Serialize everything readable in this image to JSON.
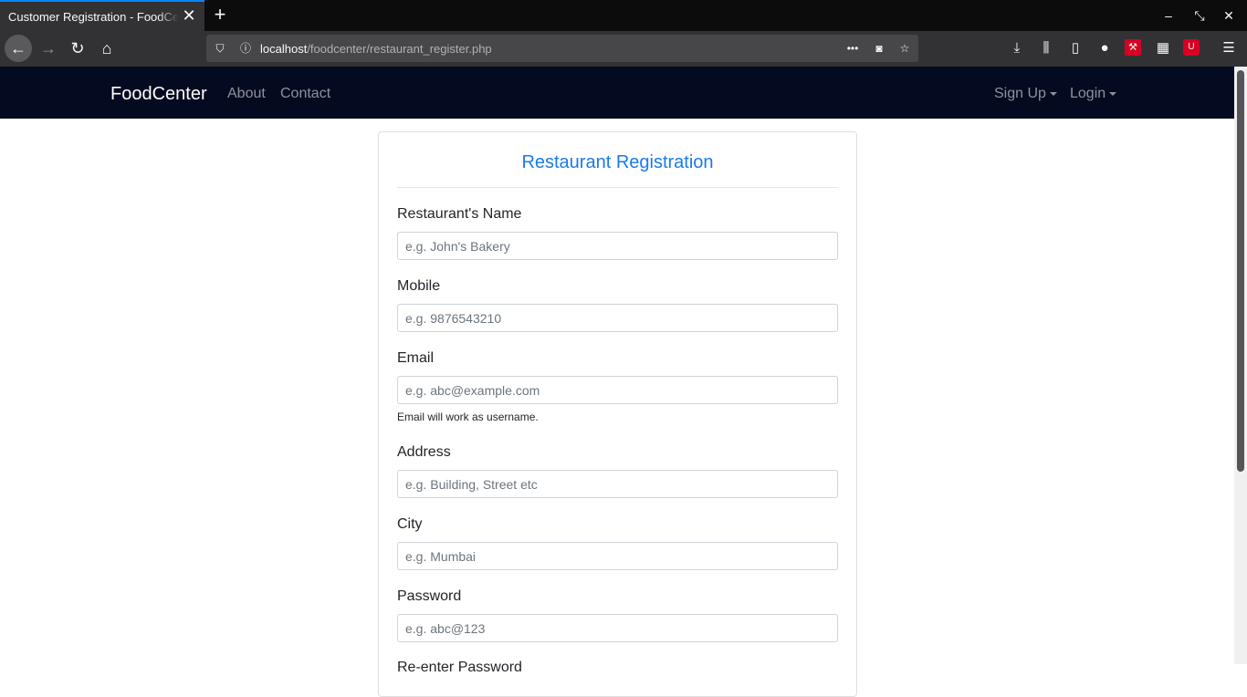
{
  "browser": {
    "tab_title": "Customer Registration - FoodCenter",
    "url_host": "localhost",
    "url_path": "/foodcenter/restaurant_register.php"
  },
  "site": {
    "brand": "FoodCenter",
    "nav": {
      "about": "About",
      "contact": "Contact",
      "signup": "Sign Up",
      "login": "Login"
    }
  },
  "form": {
    "title": "Restaurant Registration",
    "fields": [
      {
        "label": "Restaurant's Name",
        "placeholder": "e.g. John's Bakery"
      },
      {
        "label": "Mobile",
        "placeholder": "e.g. 9876543210"
      },
      {
        "label": "Email",
        "placeholder": "e.g. abc@example.com",
        "help": "Email will work as username."
      },
      {
        "label": "Address",
        "placeholder": "e.g. Building, Street etc"
      },
      {
        "label": "City",
        "placeholder": "e.g. Mumbai"
      },
      {
        "label": "Password",
        "placeholder": "e.g. abc@123"
      }
    ],
    "next_label_partial": "Re-enter Password"
  },
  "colors": {
    "accent": "#1a7bea",
    "navbar": "#040a1f"
  }
}
